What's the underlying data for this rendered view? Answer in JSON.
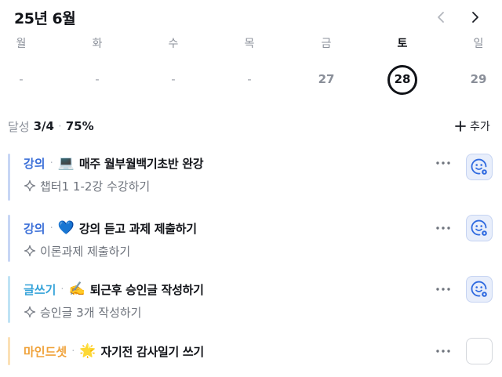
{
  "header": {
    "month_title": "25년 6월"
  },
  "nav": {
    "prev_icon": "chevron-left-icon",
    "next_icon": "chevron-right-icon"
  },
  "week": [
    {
      "dow": "월",
      "date": "-",
      "selected": false
    },
    {
      "dow": "화",
      "date": "-",
      "selected": false
    },
    {
      "dow": "수",
      "date": "-",
      "selected": false
    },
    {
      "dow": "목",
      "date": "-",
      "selected": false
    },
    {
      "dow": "금",
      "date": "27",
      "selected": false
    },
    {
      "dow": "토",
      "date": "28",
      "selected": true
    },
    {
      "dow": "일",
      "date": "29",
      "selected": false
    }
  ],
  "summary": {
    "label": "달성",
    "count": "3/4",
    "separator": "·",
    "percent": "75%"
  },
  "add_button": {
    "label": "추가",
    "icon": "plus-icon"
  },
  "tasks": [
    {
      "category": "강의",
      "category_color": "#3b6fd8",
      "bar_color": "#c7d6f5",
      "emoji": "💻",
      "title": "매주 월부월백기초반 완강",
      "subtitle": "챕터1 1-2강 수강하기",
      "done": true
    },
    {
      "category": "강의",
      "category_color": "#3b6fd8",
      "bar_color": "#c7d6f5",
      "emoji": "💙",
      "title": "강의 듣고 과제 제출하기",
      "subtitle": "이론과제 제출하기",
      "done": true
    },
    {
      "category": "글쓰기",
      "category_color": "#35a3d9",
      "bar_color": "#bfe3f5",
      "emoji": "✍️",
      "title": "퇴근후 승인글 작성하기",
      "subtitle": "승인글 3개 작성하기",
      "done": true
    },
    {
      "category": "마인드셋",
      "category_color": "#f0a23a",
      "bar_color": "#fbe0b5",
      "emoji": "🌟",
      "title": "자기전 감사일기 쓰기",
      "subtitle": "",
      "done": false
    }
  ],
  "colors": {
    "accent": "#2f6ae0",
    "done_bg": "#e8eefb"
  }
}
